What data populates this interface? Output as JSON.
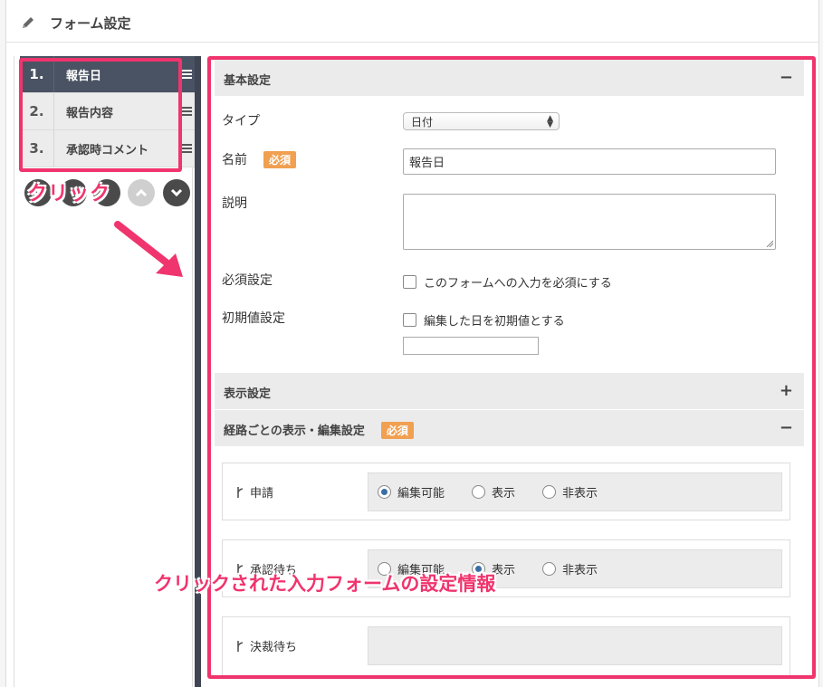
{
  "header": {
    "title": "フォーム設定",
    "icon": "pencil-icon"
  },
  "form_items": [
    {
      "num": "1.",
      "label": "報告日",
      "active": true
    },
    {
      "num": "2.",
      "label": "報告内容",
      "active": false
    },
    {
      "num": "3.",
      "label": "承認時コメント",
      "active": false
    }
  ],
  "annotations": {
    "click": "クリック",
    "info": "クリックされた入力フォームの設定情報",
    "highlight_color": "#f0346e"
  },
  "basic": {
    "title": "基本設定",
    "toggle": "−",
    "type_label": "タイプ",
    "type_value": "日付",
    "name_label": "名前",
    "required_badge": "必須",
    "name_value": "報告日",
    "desc_label": "説明",
    "required_label": "必須設定",
    "required_check": "このフォームへの入力を必須にする",
    "initial_label": "初期値設定",
    "initial_check": "編集した日を初期値とする"
  },
  "display": {
    "title": "表示設定",
    "toggle": "+"
  },
  "route": {
    "title": "経路ごとの表示・編集設定",
    "required_badge": "必須",
    "toggle": "−",
    "options": [
      "編集可能",
      "表示",
      "非表示"
    ],
    "rows": [
      {
        "name": "申請",
        "selected": 0
      },
      {
        "name": "承認待ち",
        "selected": 1
      },
      {
        "name": "決裁待ち",
        "selected": -1
      }
    ]
  },
  "colors": {
    "badge": "#f0a050",
    "active_item": "#4a5363",
    "radio_dot": "#3a6ea5"
  }
}
